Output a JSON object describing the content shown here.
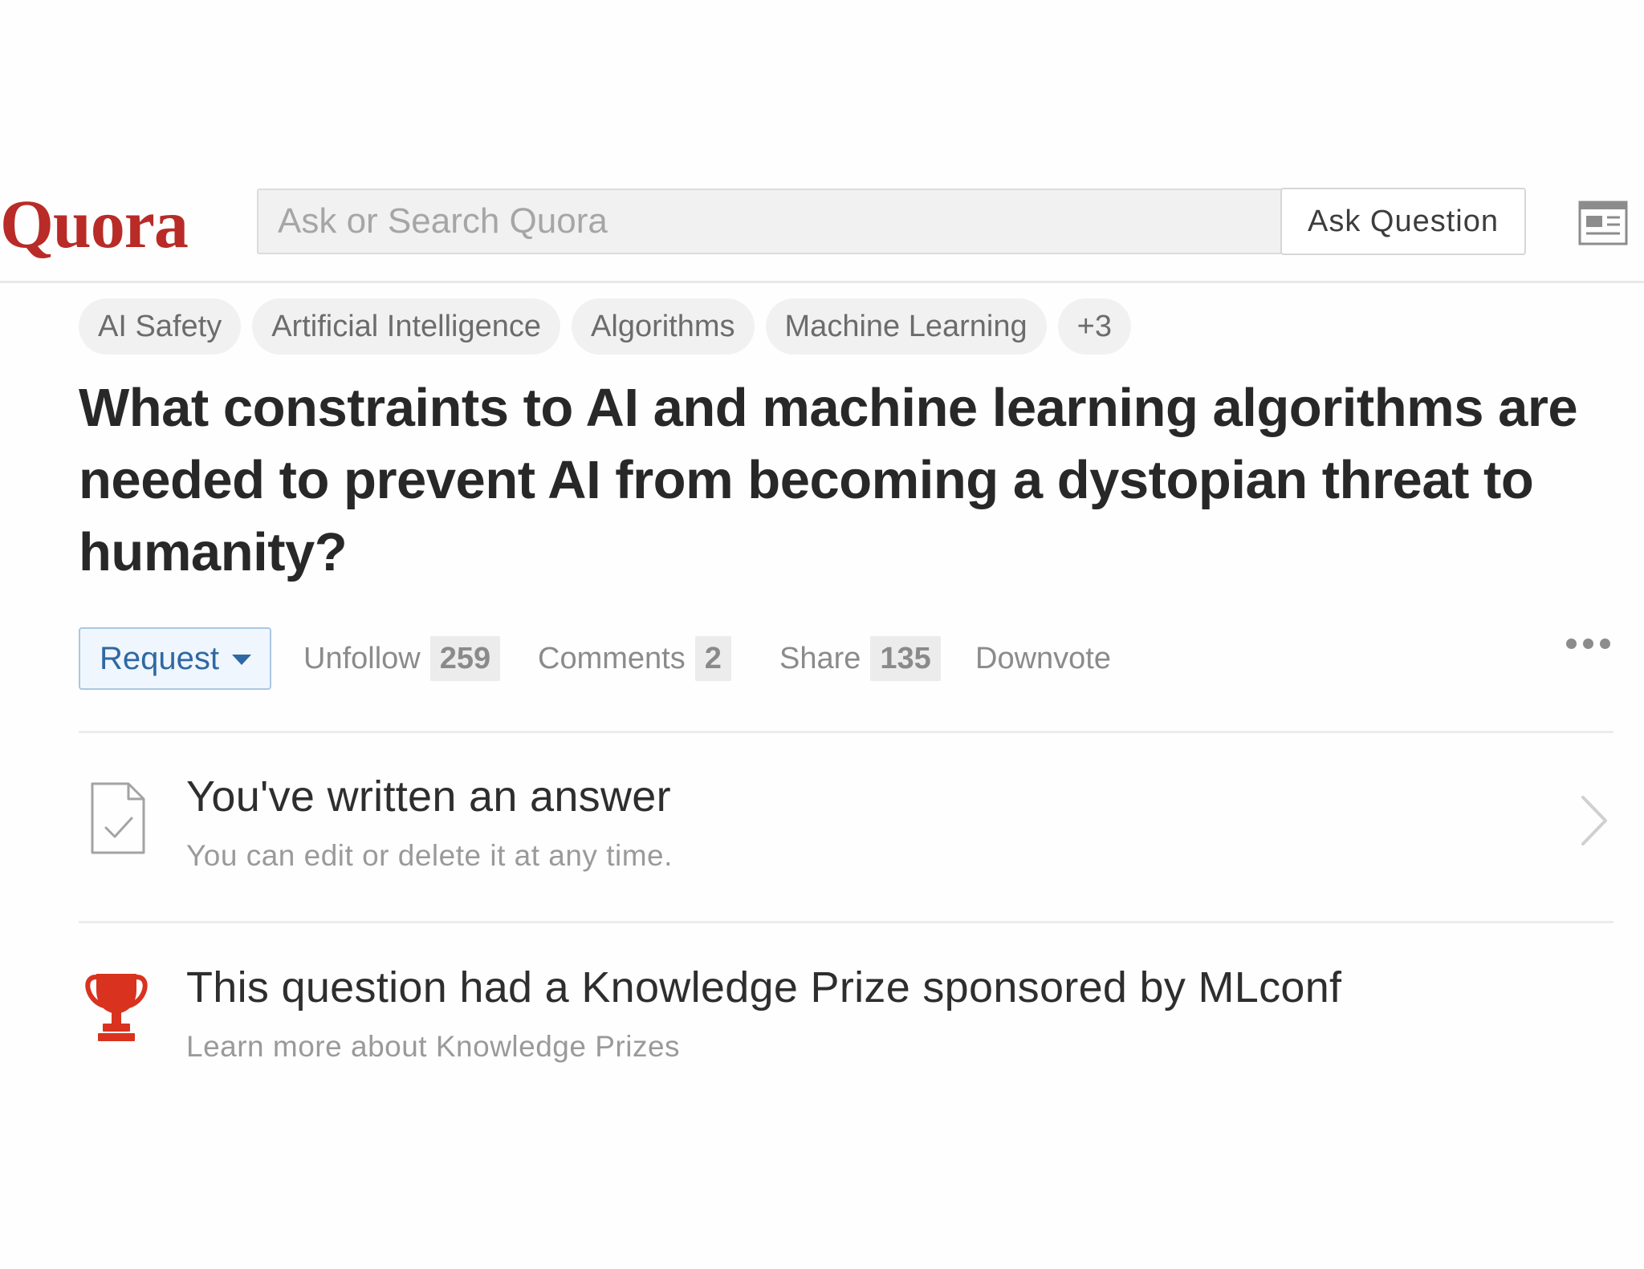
{
  "header": {
    "logo": "Quora",
    "search_placeholder": "Ask or Search Quora",
    "ask_button": "Ask Question",
    "news_icon": "newspaper-icon"
  },
  "topics": [
    "AI Safety",
    "Artificial Intelligence",
    "Algorithms",
    "Machine Learning",
    "+3"
  ],
  "question": {
    "title": "What constraints to AI and machine learning algorithms are needed to prevent AI from becoming a dystopian threat to humanity?"
  },
  "actions": {
    "request": "Request",
    "unfollow": "Unfollow",
    "unfollow_count": "259",
    "comments": "Comments",
    "comments_count": "2",
    "share": "Share",
    "share_count": "135",
    "downvote": "Downvote",
    "more_icon": "more-dots-icon"
  },
  "answer_notice": {
    "icon": "document-check-icon",
    "title": "You've written an answer",
    "subtitle": "You can edit or delete it at any time."
  },
  "prize_notice": {
    "icon": "trophy-icon",
    "title": "This question had a Knowledge Prize sponsored by MLconf",
    "link": "Learn more about Knowledge Prizes"
  },
  "colors": {
    "brand": "#b92b27",
    "link_blue": "#2e69a3",
    "trophy_red": "#d9321f"
  }
}
